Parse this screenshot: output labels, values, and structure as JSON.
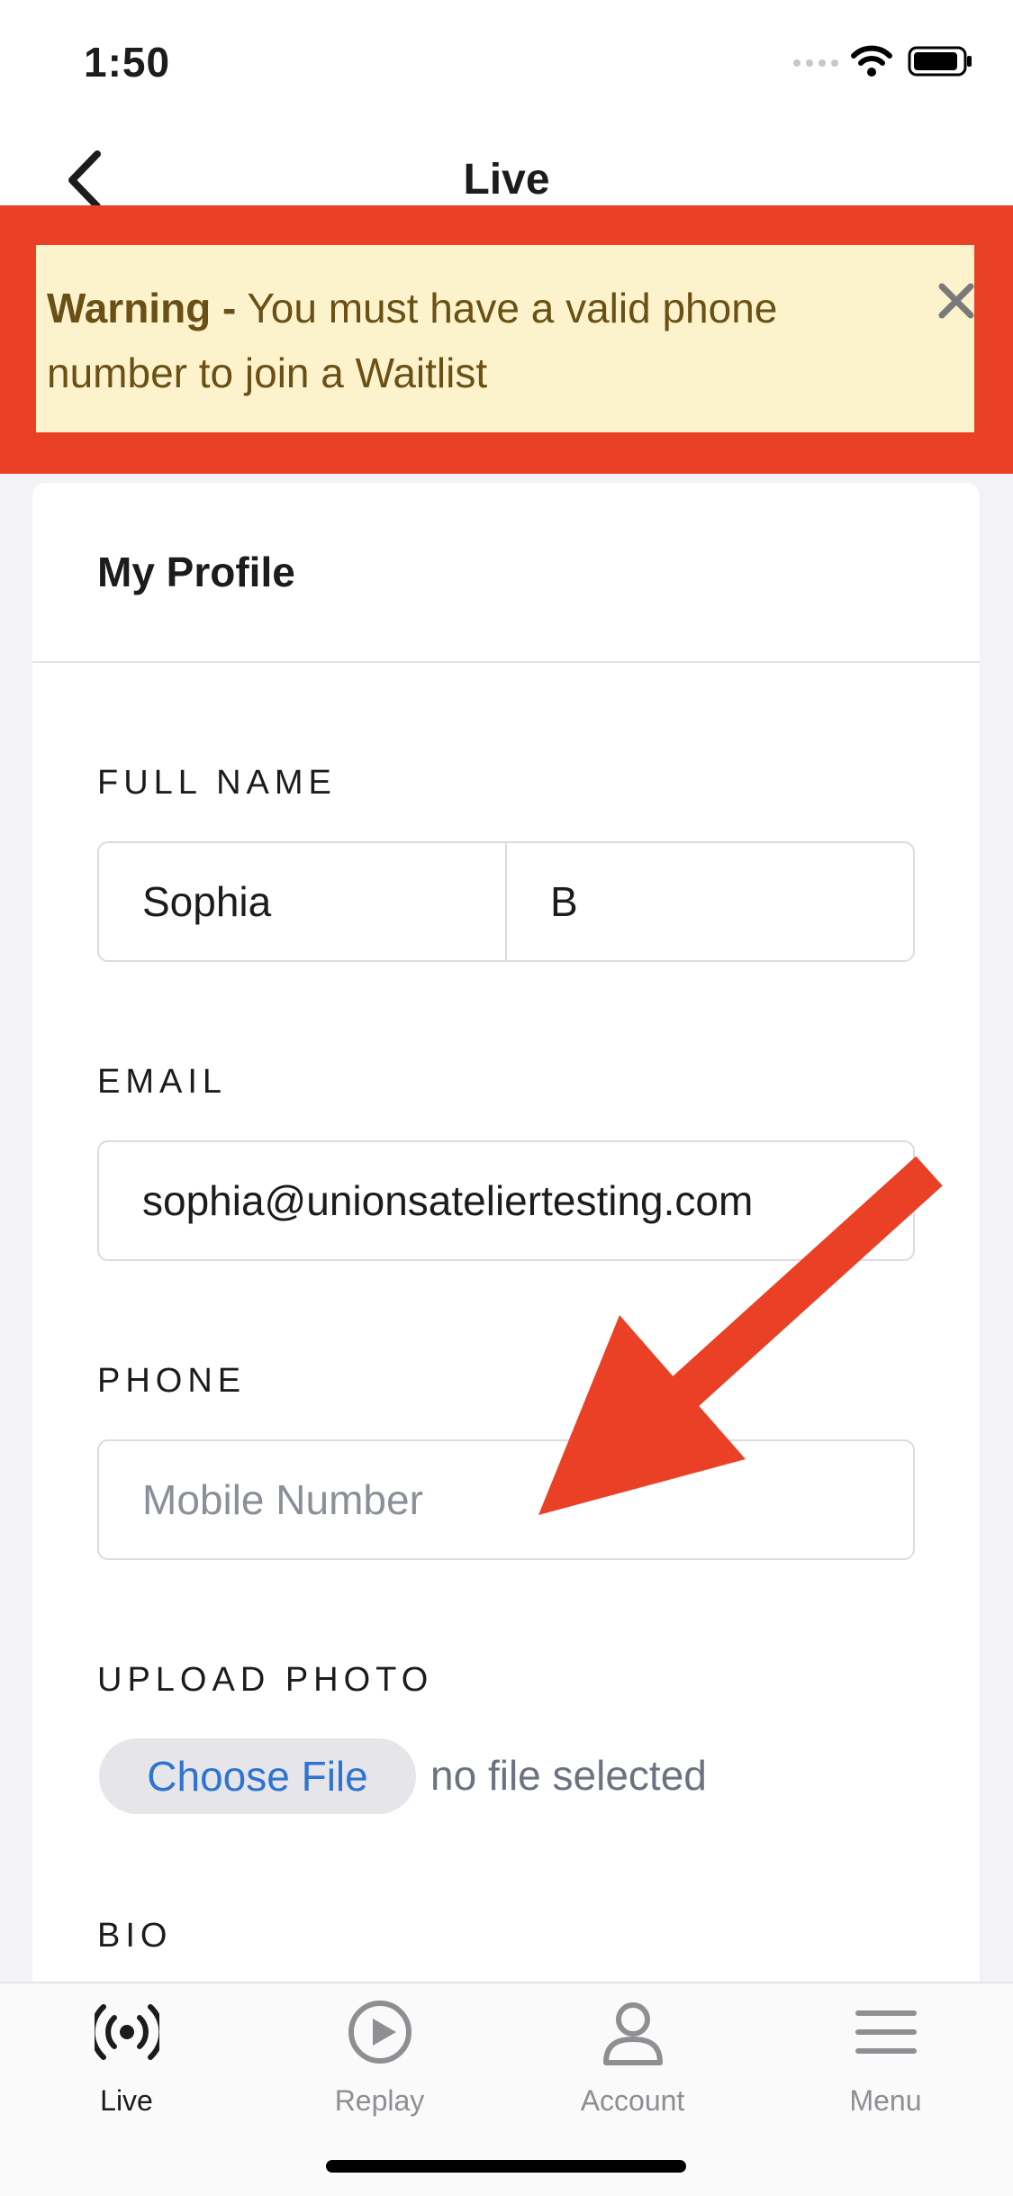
{
  "status_bar": {
    "time": "1:50"
  },
  "nav": {
    "title": "Live",
    "back_icon": "chevron-left-icon"
  },
  "warning": {
    "strong": "Warning -",
    "message": "You must have a valid phone number to join a Waitlist",
    "close_icon": "close-icon",
    "highlight_color": "#ea4126",
    "background_color": "#fcf3cd"
  },
  "profile": {
    "title": "My Profile",
    "full_name": {
      "label": "FULL NAME",
      "first": "Sophia",
      "last": "B"
    },
    "email": {
      "label": "EMAIL",
      "value": "sophia@unionsateliertesting.com"
    },
    "phone": {
      "label": "PHONE",
      "placeholder": "Mobile Number"
    },
    "upload_photo": {
      "label": "UPLOAD PHOTO",
      "button": "Choose File",
      "status": "no file selected"
    },
    "bio": {
      "label": "BIO"
    }
  },
  "annotation": {
    "arrow_color": "#ea4126",
    "points_to": "phone input"
  },
  "tabs": [
    {
      "label": "Live",
      "icon": "live-broadcast-icon",
      "active": true
    },
    {
      "label": "Replay",
      "icon": "play-circle-icon",
      "active": false
    },
    {
      "label": "Account",
      "icon": "account-person-icon",
      "active": false
    },
    {
      "label": "Menu",
      "icon": "menu-hamburger-icon",
      "active": false
    }
  ]
}
